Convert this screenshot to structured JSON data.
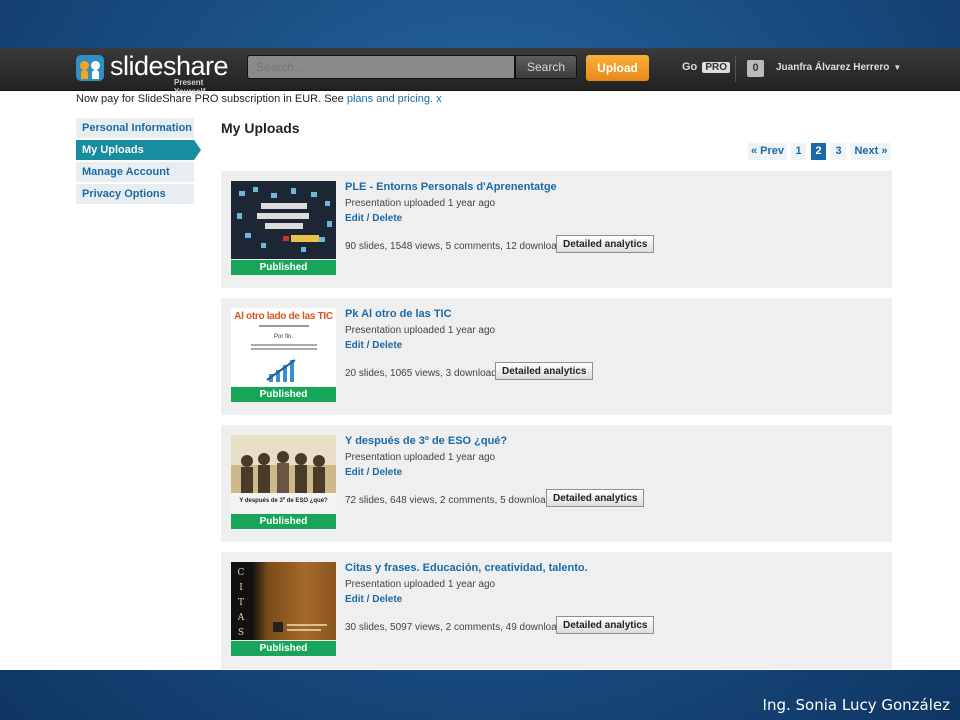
{
  "brand": {
    "name": "slideshare",
    "tagline": "Present Yourself"
  },
  "header": {
    "search_placeholder": "Search...",
    "search_label": "Search",
    "upload_label": "Upload",
    "go_label": "Go",
    "pro_label": "PRO",
    "notifications": "0",
    "user_name": "Juanfra Álvarez Herrero",
    "caret": "▼"
  },
  "notice": {
    "text": "Now pay for SlideShare PRO subscription in EUR. See",
    "link": "plans and pricing.",
    "close": "x"
  },
  "sidebar": {
    "items": [
      {
        "label": "Personal Information"
      },
      {
        "label": "My Uploads"
      },
      {
        "label": "Manage Account"
      },
      {
        "label": "Privacy Options"
      }
    ]
  },
  "main": {
    "title": "My Uploads",
    "pager": {
      "prev": "« Prev",
      "pages": [
        "1",
        "2",
        "3"
      ],
      "current": "2",
      "next": "Next »"
    }
  },
  "uploads": [
    {
      "title": "PLE - Entorns Personals d'Aprenentatge",
      "subtitle": "Presentation uploaded 1 year ago",
      "edit": "Edit / Delete",
      "stats": "90 slides, 1548 views, 5 comments, 12 downloads",
      "analytics": "Detailed analytics",
      "status": "Published"
    },
    {
      "title": "Pk Al otro de las TIC",
      "subtitle": "Presentation uploaded 1 year ago",
      "edit": "Edit / Delete",
      "stats": "20 slides, 1065 views, 3 downloads",
      "analytics": "Detailed analytics",
      "status": "Published",
      "thumb_heading": "Al otro lado de las TIC",
      "thumb_text": "Por fin."
    },
    {
      "title": "Y después de 3º de ESO ¿qué?",
      "subtitle": "Presentation uploaded 1 year ago",
      "edit": "Edit / Delete",
      "stats": "72 slides, 648 views, 2 comments, 5 downloads",
      "analytics": "Detailed analytics",
      "status": "Published",
      "thumb_caption": "Y después de 3º de ESO ¿qué?"
    },
    {
      "title": "Citas y frases. Educación, creatividad, talento.",
      "subtitle": "Presentation uploaded 1 year ago",
      "edit": "Edit / Delete",
      "stats": "30 slides, 5097 views, 2 comments, 49 downloads",
      "analytics": "Detailed analytics",
      "status": "Published",
      "thumb_letters": [
        "C",
        "I",
        "T",
        "A",
        "S"
      ]
    }
  ],
  "credit": "Ing. Sonia Lucy González",
  "colors": {
    "accent": "#168e9f",
    "link": "#1b6aa8",
    "published": "#18a55a",
    "upload": "#f39a25"
  }
}
